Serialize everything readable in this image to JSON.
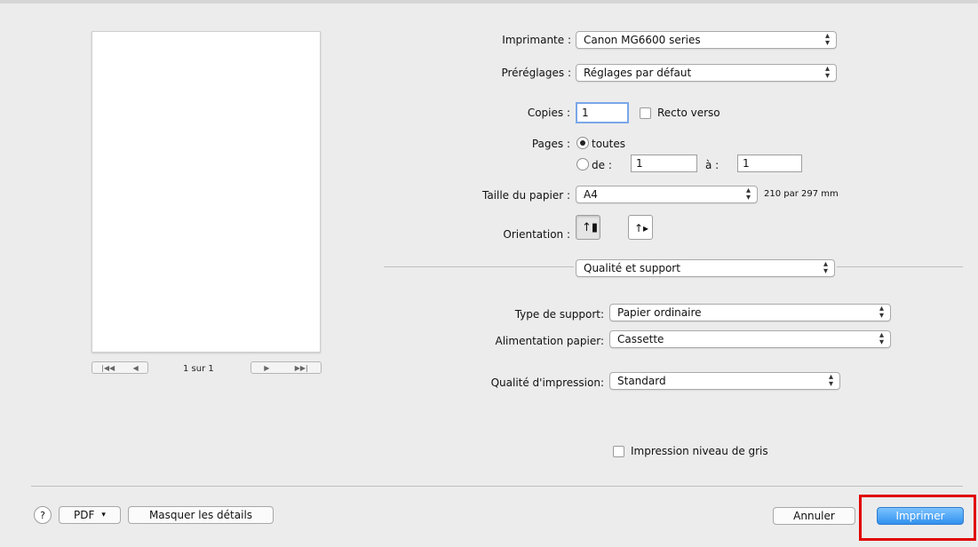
{
  "printer": {
    "label": "Imprimante :",
    "value": "Canon MG6600 series"
  },
  "presets": {
    "label": "Préréglages :",
    "value": "Réglages par défaut"
  },
  "copies": {
    "label": "Copies :",
    "value": "1",
    "duplex_label": "Recto verso",
    "duplex_checked": false
  },
  "pages": {
    "label": "Pages :",
    "all_label": "toutes",
    "from_label": "de :",
    "from_value": "1",
    "to_label": "à :",
    "to_value": "1",
    "selected": "toutes"
  },
  "paper_size": {
    "label": "Taille du papier :",
    "value": "A4",
    "dimensions": "210 par 297 mm"
  },
  "orientation": {
    "label": "Orientation :",
    "selected": "portrait",
    "options": [
      "portrait",
      "landscape"
    ]
  },
  "section": {
    "value": "Qualité et support"
  },
  "media_type": {
    "label": "Type de support:",
    "value": "Papier ordinaire"
  },
  "paper_source": {
    "label": "Alimentation papier:",
    "value": "Cassette"
  },
  "print_quality": {
    "label": "Qualité d'impression:",
    "value": "Standard"
  },
  "grayscale": {
    "label": "Impression niveau de gris",
    "checked": false
  },
  "preview": {
    "page_counter": "1 sur 1"
  },
  "footer": {
    "help": "?",
    "pdf_label": "PDF",
    "hide_details_label": "Masquer les détails",
    "cancel_label": "Annuler",
    "print_label": "Imprimer"
  },
  "colors": {
    "accent": "#3291ee",
    "highlight": "#e10000",
    "background": "#ececec"
  }
}
